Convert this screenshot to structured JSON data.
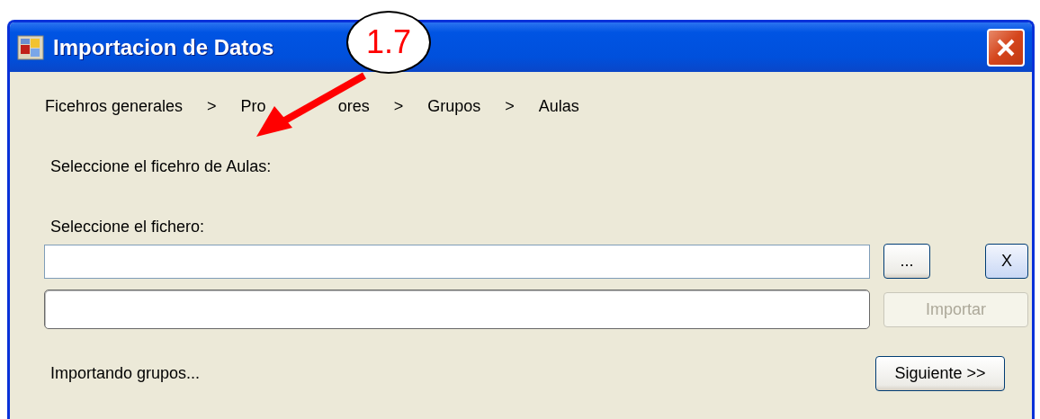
{
  "window": {
    "title": "Importacion de Datos"
  },
  "callout": {
    "label": "1.7"
  },
  "breadcrumb": {
    "separator": ">",
    "steps": [
      {
        "parts": [
          "Ficehros generales"
        ]
      },
      {
        "parts": [
          "Pro",
          "ores"
        ]
      },
      {
        "parts": [
          "Grupos"
        ]
      },
      {
        "parts": [
          "Aulas"
        ]
      }
    ]
  },
  "heading": "Seleccione el ficehro de Aulas:",
  "file_label": "Seleccione el fichero:",
  "browse_button": {
    "label": "...",
    "disabled": false
  },
  "clear_button": {
    "label": "X",
    "disabled": false
  },
  "import_button": {
    "label": "Importar",
    "disabled": true
  },
  "status": "Importando grupos...",
  "next_button": {
    "label": "Siguiente >>",
    "disabled": false
  }
}
